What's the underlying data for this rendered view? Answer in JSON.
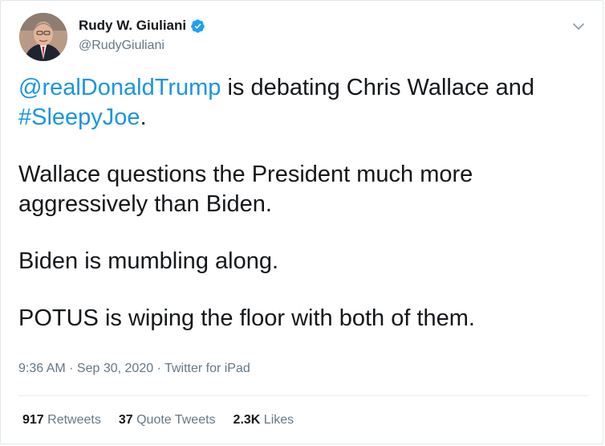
{
  "author": {
    "name": "Rudy W. Giuliani",
    "handle": "@RudyGiuliani",
    "verified_icon": "verified-badge-icon"
  },
  "tweet": {
    "line1_mention": "@realDonaldTrump",
    "line1_text": " is debating Chris Wallace and",
    "line1_hashtag": "#SleepyJoe",
    "line1_end": ".",
    "para2": "Wallace questions the President much more aggressively than Biden.",
    "para3": "Biden is mumbling along.",
    "para4": "POTUS is wiping the floor with both of them."
  },
  "meta": {
    "time": "9:36 AM",
    "sep1": " · ",
    "date": "Sep 30, 2020",
    "sep2": " · ",
    "source": "Twitter for iPad"
  },
  "stats": {
    "retweets_count": "917",
    "retweets_label": "Retweets",
    "quotes_count": "37",
    "quotes_label": "Quote Tweets",
    "likes_count": "2.3K",
    "likes_label": "Likes"
  },
  "colors": {
    "link": "#1b95e0",
    "secondary": "#657786",
    "verified": "#1da1f2"
  }
}
